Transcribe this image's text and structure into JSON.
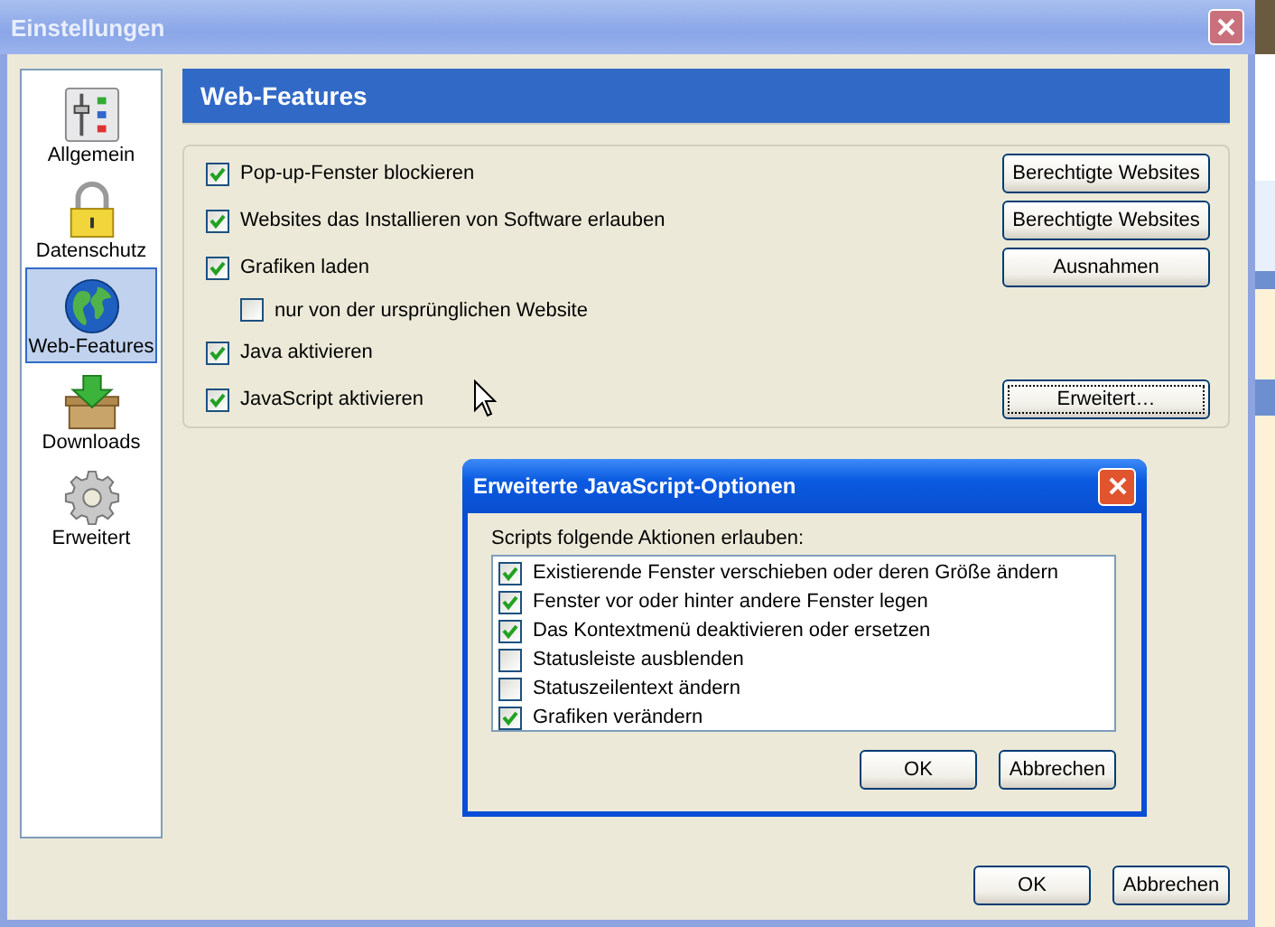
{
  "window": {
    "title": "Einstellungen"
  },
  "sidebar": {
    "items": [
      {
        "label": "Allgemein",
        "kind": "general",
        "selected": false
      },
      {
        "label": "Datenschutz",
        "kind": "privacy",
        "selected": false
      },
      {
        "label": "Web-Features",
        "kind": "web",
        "selected": true
      },
      {
        "label": "Downloads",
        "kind": "downloads",
        "selected": false
      },
      {
        "label": "Erweitert",
        "kind": "advanced",
        "selected": false
      }
    ]
  },
  "panel": {
    "title": "Web-Features",
    "options": [
      {
        "label": "Pop-up-Fenster blockieren",
        "checked": true,
        "button": {
          "label": "Berechtigte Websites",
          "focused": false
        }
      },
      {
        "label": "Websites das Installieren von Software erlauben",
        "checked": true,
        "button": {
          "label": "Berechtigte Websites",
          "focused": false
        }
      },
      {
        "label": "Grafiken laden",
        "checked": true,
        "button": {
          "label": "Ausnahmen",
          "focused": false
        },
        "children": [
          {
            "label": "nur von der ursprünglichen Website",
            "checked": false
          }
        ]
      },
      {
        "label": "Java aktivieren",
        "checked": true
      },
      {
        "label": "JavaScript aktivieren",
        "checked": true,
        "button": {
          "label": "Erweitert…",
          "focused": true
        }
      }
    ]
  },
  "dialog": {
    "title": "Erweiterte JavaScript-Optionen",
    "caption": "Scripts folgende Aktionen erlauben:",
    "items": [
      {
        "label": "Existierende Fenster verschieben oder deren Größe ändern",
        "checked": true
      },
      {
        "label": "Fenster vor oder hinter andere Fenster legen",
        "checked": true
      },
      {
        "label": "Das Kontextmenü deaktivieren oder ersetzen",
        "checked": true
      },
      {
        "label": "Statusleiste ausblenden",
        "checked": false
      },
      {
        "label": "Statuszeilentext ändern",
        "checked": false
      },
      {
        "label": "Grafiken verändern",
        "checked": true
      }
    ],
    "buttons": [
      "OK",
      "Abbrechen"
    ]
  },
  "buttons": [
    "OK",
    "Abbrechen"
  ]
}
